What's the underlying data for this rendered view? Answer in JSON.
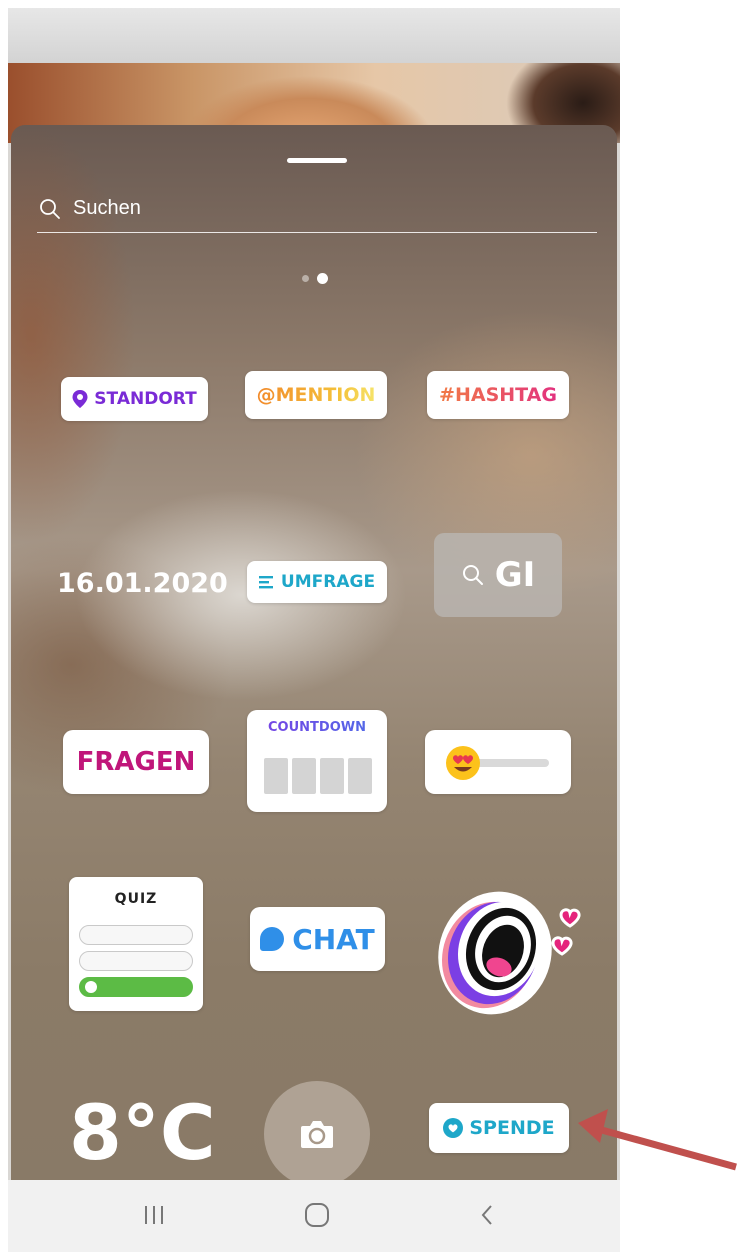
{
  "search": {
    "placeholder": "Suchen"
  },
  "pagination": {
    "pages": 2,
    "active_index": 1
  },
  "stickers": {
    "standort": {
      "label": "STANDORT",
      "icon": "location-pin-icon"
    },
    "mention": {
      "label": "@MENTION"
    },
    "hashtag": {
      "label": "#HASHTAG"
    },
    "date": {
      "label": "16.01.2020"
    },
    "umfrage": {
      "label": "UMFRAGE",
      "icon": "poll-lines-icon"
    },
    "gif": {
      "label": "GI",
      "icon": "search-icon"
    },
    "fragen": {
      "label": "FRAGEN"
    },
    "countdown": {
      "label": "COUNTDOWN"
    },
    "emoji_slider": {
      "emoji": "heart-eyes-emoji"
    },
    "quiz": {
      "label": "QUIZ"
    },
    "chat": {
      "label": "CHAT",
      "icon": "chat-bubble-icon"
    },
    "mouth": {
      "icon": "screaming-mouth-sticker"
    },
    "temperature": {
      "label": "8°C"
    },
    "spende": {
      "label": "SPENDE",
      "icon": "heart-circle-icon"
    }
  },
  "navbar": {
    "recent_apps": {
      "label": "|||",
      "icon": "recent-apps-icon"
    },
    "home": {
      "icon": "home-icon"
    },
    "back": {
      "icon": "back-icon"
    }
  },
  "colors": {
    "standort": "#7a2bd6",
    "umfrage": "#1ea7c9",
    "fragen": "#c0167a",
    "chat": "#2f8fe8",
    "spende": "#1ea7c9",
    "annotation_arrow": "#c0504d"
  }
}
